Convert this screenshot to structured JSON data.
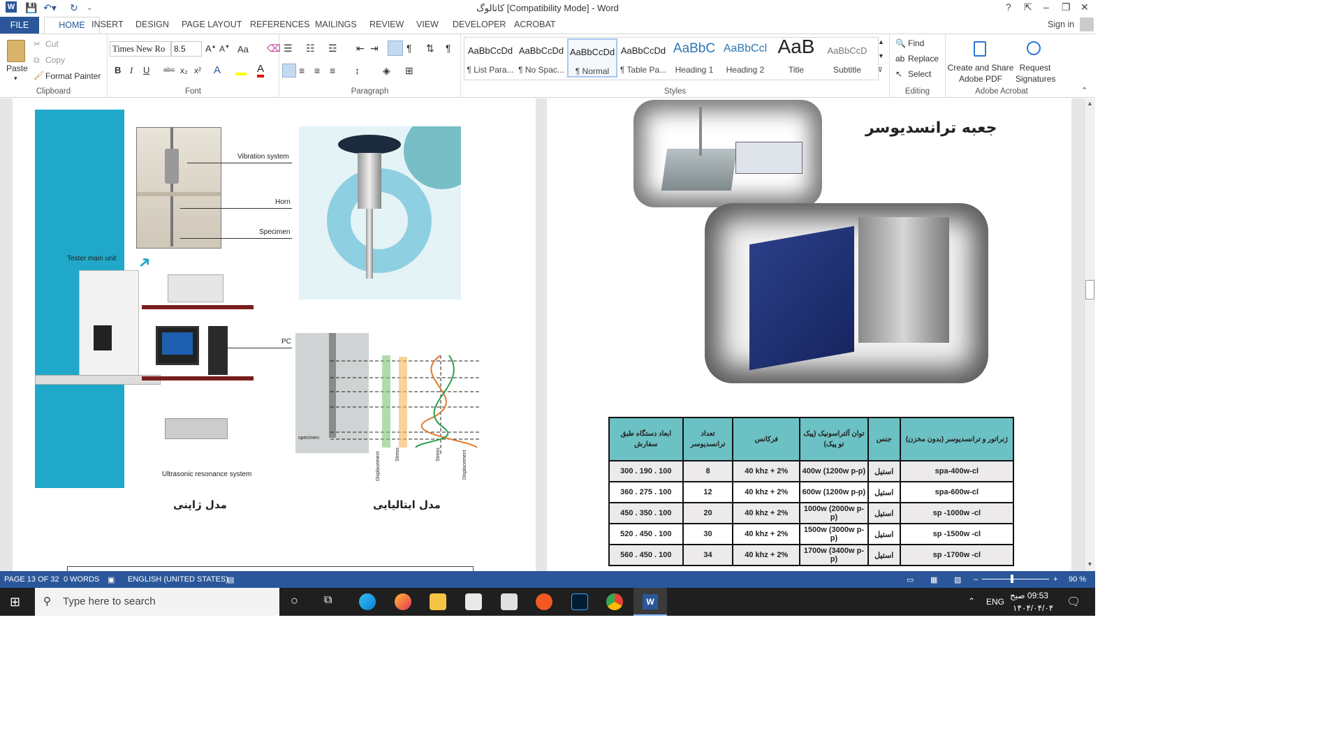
{
  "window": {
    "title": "کاتالوگ [Compatibility Mode] - Word",
    "help": "?",
    "signin": "Sign in"
  },
  "tabs": [
    "FILE",
    "HOME",
    "INSERT",
    "DESIGN",
    "PAGE LAYOUT",
    "REFERENCES",
    "MAILINGS",
    "REVIEW",
    "VIEW",
    "DEVELOPER",
    "ACROBAT"
  ],
  "clipboard": {
    "paste": "Paste",
    "cut": "Cut",
    "copy": "Copy",
    "format_painter": "Format Painter",
    "label": "Clipboard"
  },
  "font": {
    "name": "Times New Ro",
    "size": "8.5",
    "label": "Font",
    "bold": "B",
    "italic": "I",
    "underline": "U",
    "strike": "abc",
    "sub": "x₂",
    "sup": "x²",
    "case": "Aa"
  },
  "paragraph": {
    "label": "Paragraph"
  },
  "styles": {
    "label": "Styles",
    "items": [
      {
        "preview": "AaBbCcDd",
        "name": "¶ List Para..."
      },
      {
        "preview": "AaBbCcDd",
        "name": "¶ No Spac..."
      },
      {
        "preview": "AaBbCcDd",
        "name": "¶ Normal"
      },
      {
        "preview": "AaBbCcDd",
        "name": "¶ Table Pa..."
      },
      {
        "preview": "AaBbC",
        "name": "Heading 1"
      },
      {
        "preview": "AaBbCcl",
        "name": "Heading 2"
      },
      {
        "preview": "AaB",
        "name": "Title"
      },
      {
        "preview": "AaBbCcD",
        "name": "Subtitle"
      }
    ]
  },
  "editing": {
    "find": "Find",
    "replace": "Replace",
    "select": "Select",
    "label": "Editing"
  },
  "acrobat": {
    "create": "Create and Share Adobe PDF",
    "request": "Request Signatures",
    "label": "Adobe Acrobat"
  },
  "left_page": {
    "labels": {
      "vibration": "Vibration system",
      "horn": "Horn",
      "specimen": "Specimen",
      "tester": "Tester main unit",
      "pc": "PC",
      "resonance": "Ultrasonic resonance system",
      "specimen_small": "specimen"
    },
    "axis_labels": [
      "Displacement",
      "Stress",
      "Stress",
      "Displacement"
    ],
    "caption_japan": "مدل ژاپنی",
    "caption_italy": "مدل ایتالیایی"
  },
  "right_page": {
    "heading": "جعبه ترانسدیوسر",
    "table": {
      "headers": [
        "ژنراتور و ترانسدیوسر (بدون مخزن)",
        "جنس",
        "توان آلتراسونیک (پیک تو پیک)",
        "فرکانس",
        "تعداد ترانسدیوسر",
        "ابعاد دستگاه طبق سفارش"
      ],
      "rows": [
        [
          "spa-400w-cl",
          "استیل",
          "400w (1200w p-p)",
          "40 khz + 2%",
          "8",
          "300 . 190 . 100"
        ],
        [
          "spa-600w-cl",
          "استیل",
          "600w (1200w p-p)",
          "40 khz + 2%",
          "12",
          "360 . 275 . 100"
        ],
        [
          "sp -1000w -cl",
          "استیل",
          "1000w (2000w p-p)",
          "40 khz + 2%",
          "20",
          "450 . 350 . 100"
        ],
        [
          "sp -1500w -cl",
          "استیل",
          "1500w (3000w p-p)",
          "40 khz + 2%",
          "30",
          "520 . 450 . 100"
        ],
        [
          "sp -1700w -cl",
          "استیل",
          "1700w (3400w p-p)",
          "40 khz + 2%",
          "34",
          "560 . 450 . 100"
        ]
      ]
    }
  },
  "status": {
    "page": "PAGE 13 OF 32",
    "words": "0 WORDS",
    "language": "ENGLISH (UNITED STATES)",
    "zoom": "90 %"
  },
  "taskbar": {
    "search_placeholder": "Type here to search",
    "lang": "ENG",
    "time": "09:53 صبح",
    "date": "۱۴۰۴/۰۴/۰۴"
  }
}
